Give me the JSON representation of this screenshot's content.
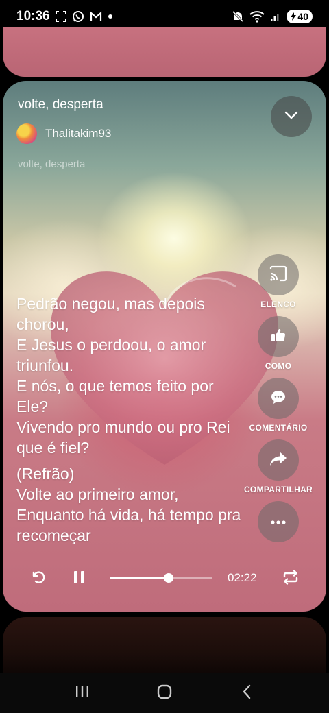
{
  "status_bar": {
    "time": "10:36",
    "battery": "40",
    "left_icons": [
      "screenshot-icon",
      "whatsapp-icon",
      "gmail-icon",
      "dot-icon"
    ],
    "right_icons": [
      "mute-icon",
      "wifi-icon",
      "signal-icon",
      "battery-icon"
    ]
  },
  "card": {
    "title": "volte, desperta",
    "author": "Thalitakim93",
    "subtitle": "volte, desperta"
  },
  "lyrics": [
    "Pedrão negou, mas depois chorou,\nE Jesus o perdoou, o amor triunfou.\nE nós, o que temos feito por Ele?\nVivendo pro mundo ou pro Rei que é fiel?",
    "(Refrão)\nVolte ao primeiro amor,\nEnquanto há vida, há tempo pra recomeçar"
  ],
  "actions": {
    "cast_label": "ELENCO",
    "like_label": "COMO",
    "comment_label": "COMENTÁRIO",
    "share_label": "COMPARTILHAR"
  },
  "player": {
    "time": "02:22",
    "progress": 0.57
  },
  "colors": {
    "card_pink": "#c7717f",
    "button_bg": "#6e6969"
  }
}
